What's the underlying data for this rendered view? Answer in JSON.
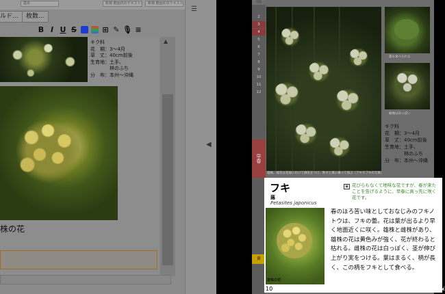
{
  "editor": {
    "topbar": [
      "基本",
      "新規 範囲内のテキストを追加",
      "新規 範囲外のテキストを追加"
    ],
    "field_buttons": [
      "ルド...",
      "枚数..."
    ],
    "toolbar_icons": [
      "bold-icon",
      "italic-icon",
      "underline-icon",
      "strike-icon",
      "font-color-icon",
      "highlight-icon",
      "image-icon",
      "pen-icon",
      "mic-icon",
      "list-icon"
    ],
    "toolbar_glyphs": [
      "B",
      "I",
      "U",
      "S",
      "",
      "",
      "⊞",
      "✎",
      "🎙",
      "≡"
    ],
    "colors": {
      "font_color": "#1a3fd0",
      "highlight": "#e0402a"
    },
    "info": [
      "キク科",
      "花　期：3～4月",
      "草　丈：40cm前後",
      "生育地：土手、",
      "　　　　林のふち",
      "分　布：本州～沖縄"
    ],
    "caption": "株の花"
  },
  "viewer": {
    "tab_numbers": [
      "2",
      "3",
      "4",
      "5",
      "6",
      "7",
      "8",
      "9",
      "10",
      "11",
      "12"
    ],
    "tab_header": "月別",
    "season_tab": "早春",
    "yellow_tab": "黄",
    "main_caption": "雄株。雌花は花後にのびて綿毛をつけ、熟すと風に乗って飛ぶ（アキタブキの写真）",
    "thumb1_caption": "葉も食べられる",
    "thumb2_caption": "雌株は白っぽい",
    "info": [
      "キク科",
      "花　期：3～4月",
      "草　丈：40cm前後",
      "生育地：土手、",
      "　　　　林のふち",
      "分　布：本州～沖縄"
    ],
    "card": {
      "title": "フキ",
      "kanji": "蕗",
      "latin": "Petasites japonicus",
      "note": "花びらもなくて地味な花ですが、春が来たことを告げるように、早春に真っ先に咲く花です。",
      "photo_caption": "雄株の花",
      "description": "春のほろ苦い味としておなじみのフキノトウは、フキの蕾。花は葉が出るより早く地面近くに咲く。雄株と雌株があり、雄株の花は黄色みが強く、花が終わると枯れる。雌株の花は白っぽく、茎が伸び上がり実をつける。葉はまるく、柄が長く、この柄をフキとして食べる。",
      "page_number": "10"
    }
  }
}
